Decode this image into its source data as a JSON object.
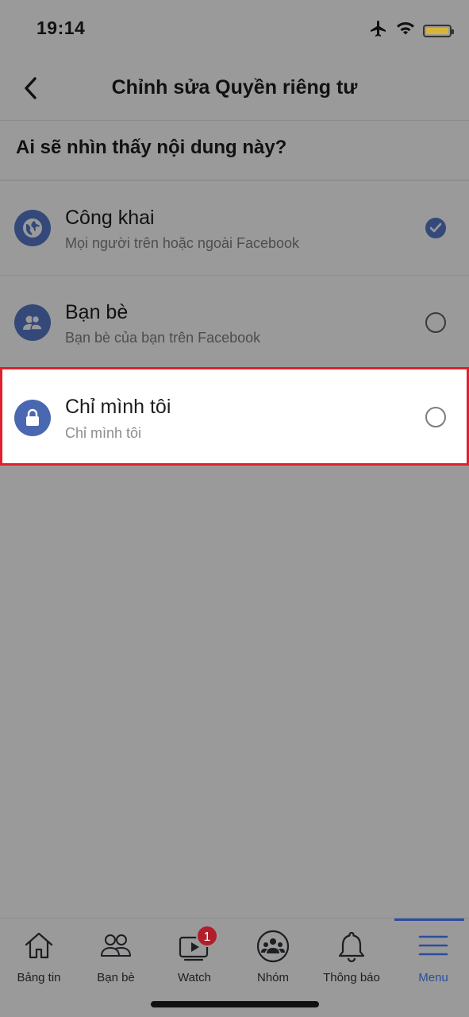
{
  "status_bar": {
    "time": "19:14"
  },
  "header": {
    "title": "Chỉnh sửa Quyền riêng tư"
  },
  "question": "Ai sẽ nhìn thấy nội dung này?",
  "options": [
    {
      "title": "Công khai",
      "subtitle": "Mọi người trên hoặc ngoài Facebook",
      "icon": "globe-icon",
      "selected": true
    },
    {
      "title": "Bạn bè",
      "subtitle": "Bạn bè của bạn trên Facebook",
      "icon": "friends-icon",
      "selected": false
    },
    {
      "title": "Chỉ mình tôi",
      "subtitle": "Chỉ mình tôi",
      "icon": "lock-icon",
      "selected": false,
      "highlighted": true
    }
  ],
  "tabs": [
    {
      "label": "Bảng tin",
      "icon": "home-icon"
    },
    {
      "label": "Bạn bè",
      "icon": "friends-icon"
    },
    {
      "label": "Watch",
      "icon": "watch-icon",
      "badge": "1"
    },
    {
      "label": "Nhóm",
      "icon": "groups-icon"
    },
    {
      "label": "Thông báo",
      "icon": "bell-icon"
    },
    {
      "label": "Menu",
      "icon": "menu-icon",
      "active": true
    }
  ],
  "colors": {
    "accent": "#2b4d9e",
    "highlight_border": "#e0202a",
    "badge": "#b01d2b",
    "overlay": "#9a9a9a"
  }
}
